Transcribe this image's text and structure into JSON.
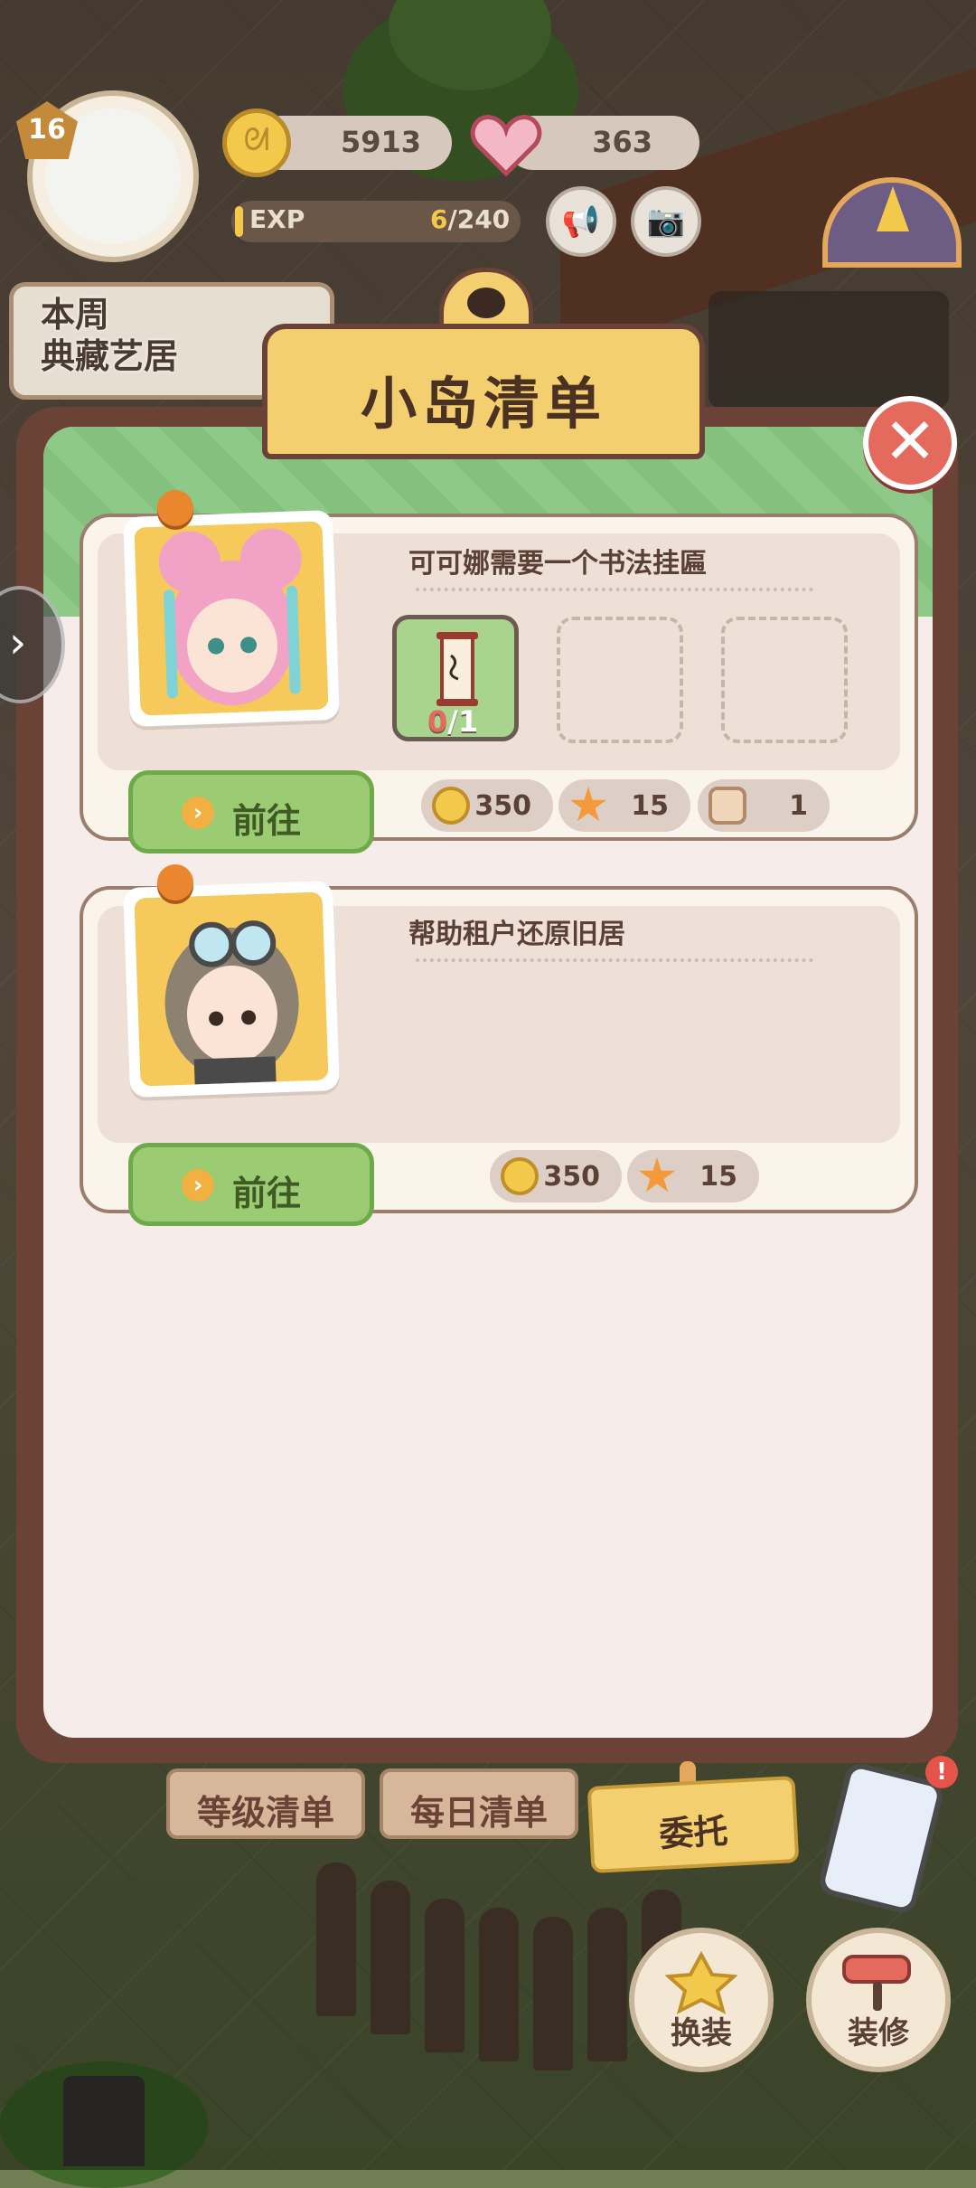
{
  "hud": {
    "level": "16",
    "coins": "5913",
    "hearts": "363",
    "exp_label": "EXP",
    "exp_current": "6",
    "exp_total": "/240",
    "exp_progress": 0.025,
    "weekly_card_line1": "本周",
    "weekly_card_line2": "典藏艺居"
  },
  "modal": {
    "title": "小岛清单",
    "close_icon": "close-icon"
  },
  "tasks": [
    {
      "title": "可可娜需要一个书法挂匾",
      "go_label": "前往",
      "slot_count_have": "0",
      "slot_count_need": "/1",
      "rewards": [
        {
          "icon": "coin-icon",
          "value": "350"
        },
        {
          "icon": "star-icon",
          "value": "15"
        },
        {
          "icon": "tin-icon",
          "value": "1"
        }
      ]
    },
    {
      "title": "帮助租户还原旧居",
      "go_label": "前往",
      "rewards": [
        {
          "icon": "coin-icon",
          "value": "350"
        },
        {
          "icon": "star-icon",
          "value": "15"
        }
      ]
    }
  ],
  "tabs": {
    "level_list": "等级清单",
    "daily_list": "每日清单",
    "commission": "委托"
  },
  "bottom": {
    "outfit": "换装",
    "decorate": "装修",
    "alert": "!"
  },
  "colors": {
    "modal_frame": "#6a4336",
    "paper": "#f6ecea",
    "title_plaque": "#f3cf70",
    "go_button": "#9bcb72",
    "close_button": "#e56a5e"
  }
}
